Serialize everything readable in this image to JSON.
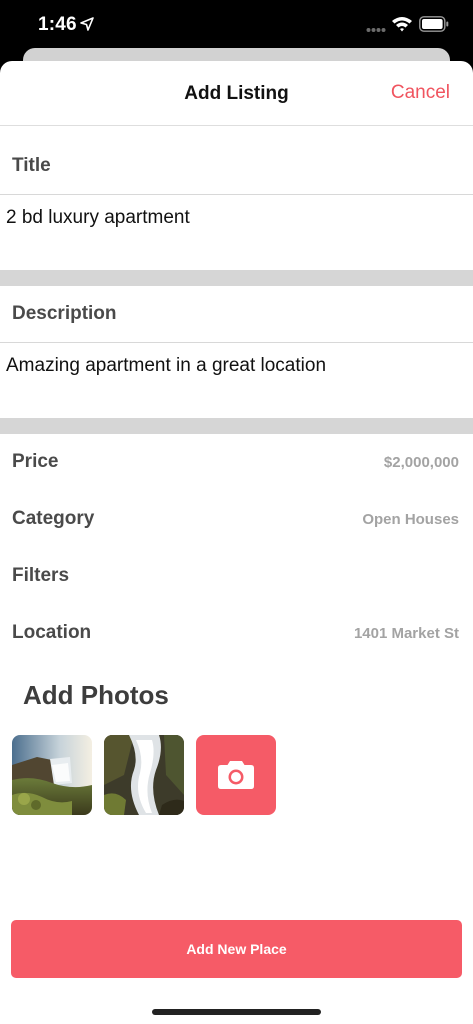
{
  "status_bar": {
    "time": "1:46"
  },
  "nav": {
    "title": "Add Listing",
    "cancel_label": "Cancel"
  },
  "form": {
    "title_label": "Title",
    "title_value": "2 bd luxury apartment",
    "description_label": "Description",
    "description_value": "Amazing apartment in a great location"
  },
  "details": [
    {
      "label": "Price",
      "value": "$2,000,000"
    },
    {
      "label": "Category",
      "value": "Open Houses"
    },
    {
      "label": "Filters",
      "value": ""
    },
    {
      "label": "Location",
      "value": "1401 Market St"
    }
  ],
  "photos": {
    "title": "Add Photos",
    "icons": [
      "waterfall-photo",
      "waterfall-photo",
      "camera-icon"
    ]
  },
  "primary_button": {
    "label": "Add New Place"
  },
  "colors": {
    "accent": "#f65b67",
    "label_text": "#4a4a4a",
    "value_text": "#a3a3a3",
    "divider_band": "#d6d6d6"
  }
}
